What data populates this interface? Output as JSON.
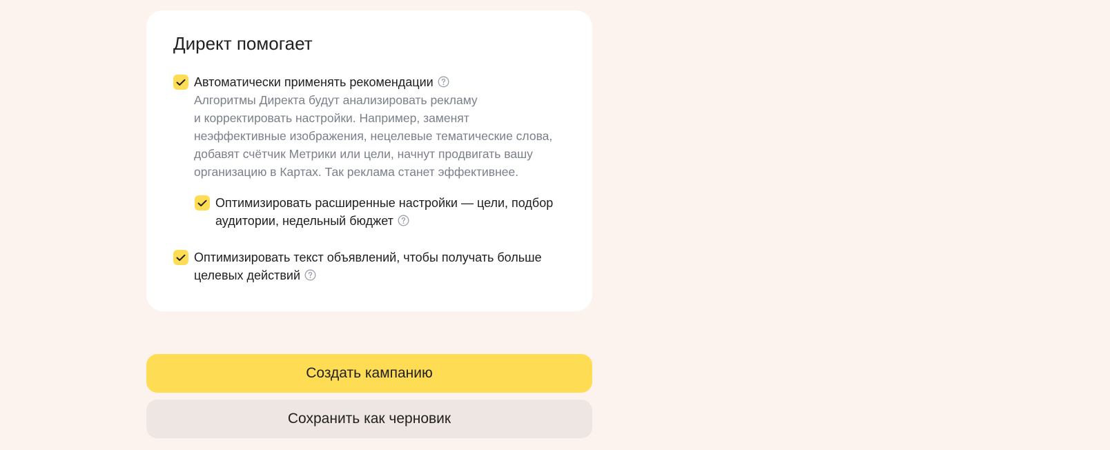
{
  "card": {
    "title": "Директ помогает",
    "options": [
      {
        "label": "Автоматически применять рекомендации",
        "checked": true,
        "description_lines": [
          "Алгоритмы Директа будут анализировать рекламу",
          "и корректировать настройки. Например, заменят",
          "неэффективные изображения, нецелевые тематические слова,",
          "добавят счётчик Метрики или цели, начнут продвигать вашу",
          "организацию в Картах. Так реклама станет эффективнее."
        ]
      },
      {
        "label_lines": [
          "Оптимизировать расширенные настройки — цели, подбор",
          "аудитории, недельный бюджет"
        ],
        "checked": true
      },
      {
        "label_lines": [
          "Оптимизировать текст объявлений, чтобы получать больше",
          "целевых действий"
        ],
        "checked": true
      }
    ]
  },
  "actions": {
    "create_label": "Создать кампанию",
    "draft_label": "Сохранить как черновик"
  },
  "colors": {
    "background": "#fcf3ee",
    "card": "#ffffff",
    "accent_yellow": "#fedd55",
    "secondary_button": "#ede6e3",
    "muted_text": "#7a7f8b"
  },
  "icons": {
    "checkbox": "check-icon",
    "help": "question-circle-icon"
  }
}
